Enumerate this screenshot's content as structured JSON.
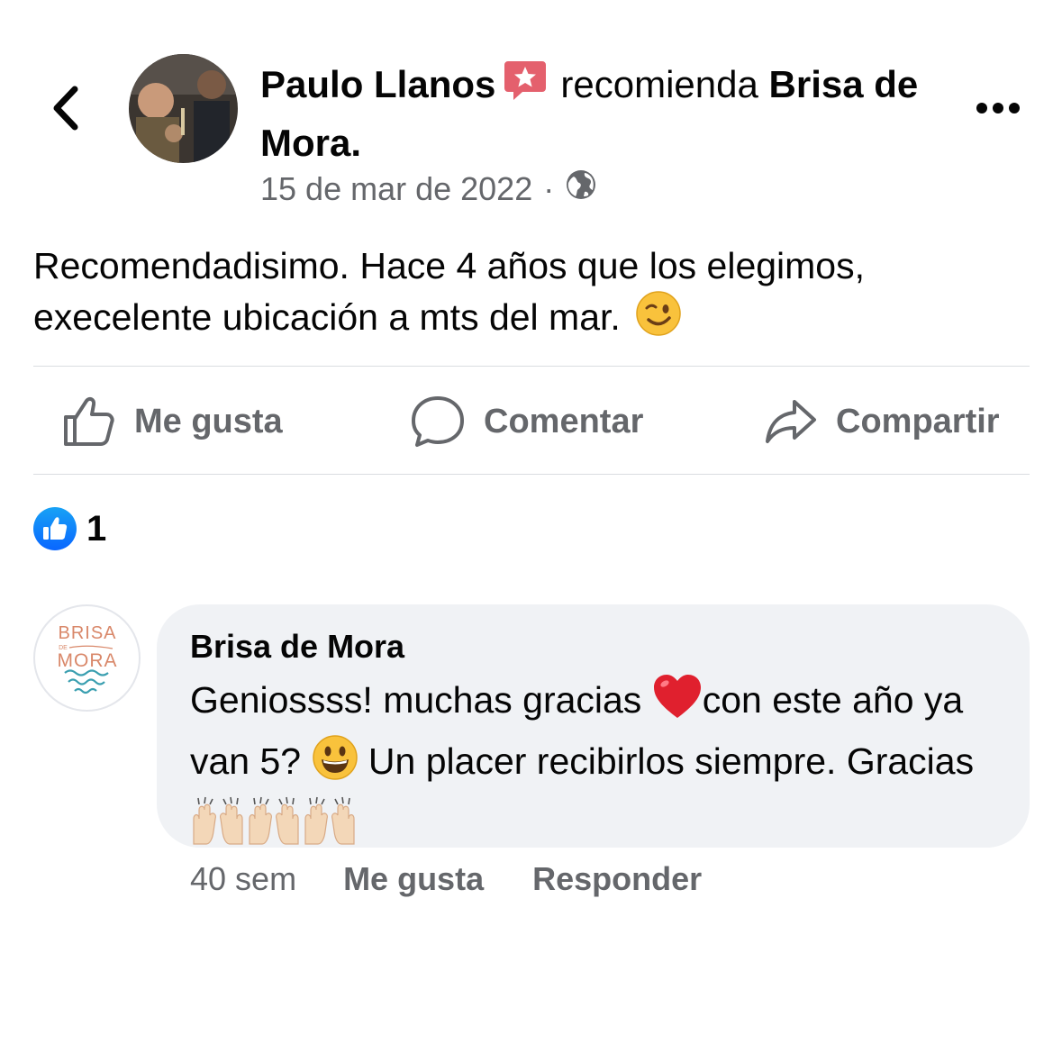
{
  "post": {
    "author": "Paulo Llanos",
    "recommends_text": "recomienda",
    "page_name": "Brisa de Mora.",
    "date": "15 de mar de 2022",
    "dot": "·",
    "privacy_icon": "globe-icon",
    "text": "Recomendadisimo. Hace 4 años que los elegimos, execelente ubicación a mts del mar."
  },
  "actions": {
    "like": "Me gusta",
    "comment": "Comentar",
    "share": "Compartir"
  },
  "reactions": {
    "count": "1",
    "icon": "like-reaction-icon"
  },
  "comment": {
    "author": "Brisa de Mora",
    "avatar_logo_lines": [
      "BRISA",
      "DE",
      "MORA"
    ],
    "text_1": "Geniossss! muchas gracias",
    "text_2": "con este año ya van 5?",
    "text_3": "Un placer recibirlos siempre. Gracias",
    "time": "40 sem",
    "like": "Me gusta",
    "reply": "Responder"
  },
  "colors": {
    "secondary_text": "#65676b",
    "bubble_bg": "#f0f2f5",
    "like_blue": "#1877f2",
    "recommend_red": "#e4606d",
    "logo_orange": "#d9886a",
    "logo_teal": "#3a9fb0"
  }
}
